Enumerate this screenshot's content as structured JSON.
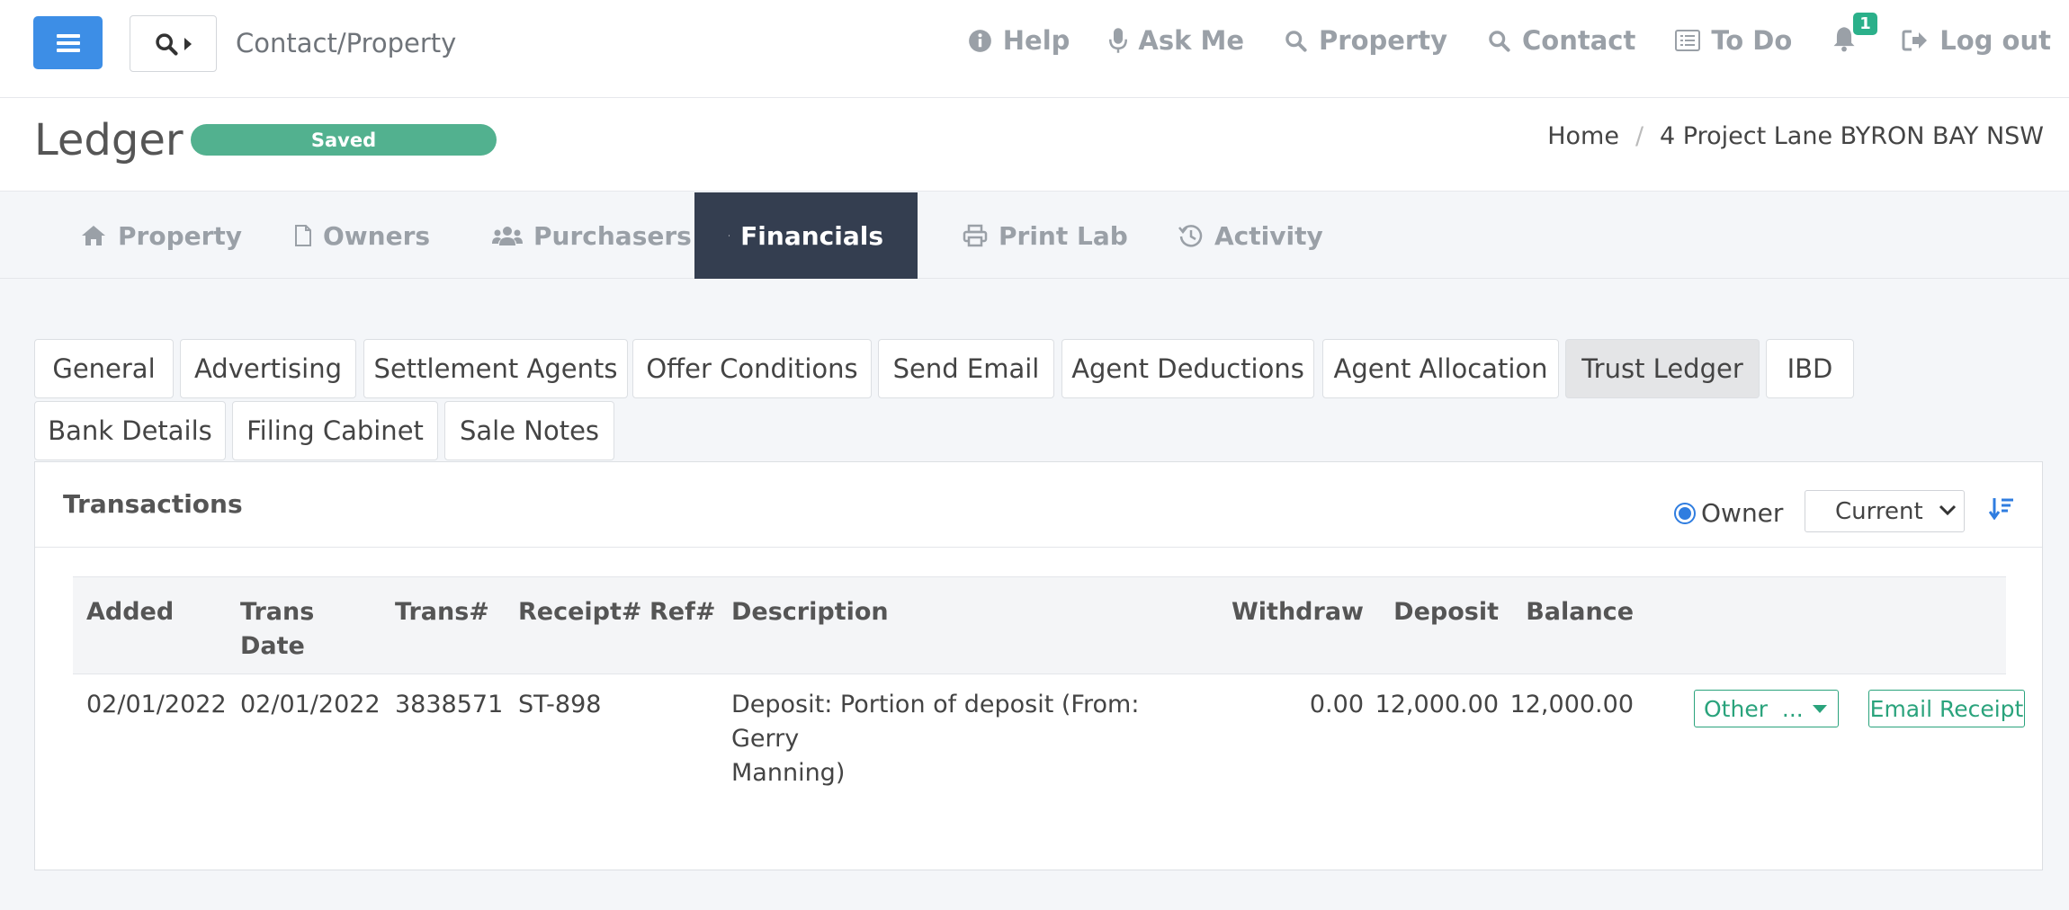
{
  "topbar": {
    "search_label": "Contact/Property",
    "nav": [
      {
        "label": "Help",
        "icon": "info-circle-icon"
      },
      {
        "label": "Ask Me",
        "icon": "microphone-icon"
      },
      {
        "label": "Property",
        "icon": "search-icon"
      },
      {
        "label": "Contact",
        "icon": "search-icon"
      },
      {
        "label": "To Do",
        "icon": "list-icon"
      }
    ],
    "notifications_count": "1",
    "logout_label": "Log out"
  },
  "header": {
    "title": "Ledger",
    "status": "Saved",
    "breadcrumb": {
      "home": "Home",
      "separator": "/",
      "current": "4 Project Lane BYRON BAY NSW"
    }
  },
  "main_tabs": [
    {
      "label": "Property",
      "icon": "home-icon"
    },
    {
      "label": "Owners",
      "icon": "file-icon"
    },
    {
      "label": "Purchasers",
      "icon": "users-icon"
    },
    {
      "label": "Financials",
      "icon": "calculator-icon",
      "active": true
    },
    {
      "label": "Print Lab",
      "icon": "printer-icon"
    },
    {
      "label": "Activity",
      "icon": "history-icon"
    }
  ],
  "sub_tabs": [
    {
      "label": "General"
    },
    {
      "label": "Advertising"
    },
    {
      "label": "Settlement Agents"
    },
    {
      "label": "Offer Conditions"
    },
    {
      "label": "Send Email"
    },
    {
      "label": "Agent Deductions"
    },
    {
      "label": "Agent Allocation"
    },
    {
      "label": "Trust Ledger",
      "active": true
    },
    {
      "label": "IBD"
    },
    {
      "label": "Bank Details"
    },
    {
      "label": "Filing Cabinet"
    },
    {
      "label": "Sale Notes"
    }
  ],
  "panel": {
    "title": "Transactions",
    "owner_label": "Owner",
    "period_value": "Current",
    "columns": {
      "added": "Added",
      "trans_date_1": "Trans",
      "trans_date_2": "Date",
      "trans_no": "Trans#",
      "receipt_no": "Receipt#",
      "ref_no": "Ref#",
      "description": "Description",
      "withdraw": "Withdraw",
      "deposit": "Deposit",
      "balance": "Balance"
    },
    "rows": [
      {
        "added": "02/01/2022",
        "trans_date": "02/01/2022",
        "trans_no": "3838571",
        "receipt_no": "ST-898",
        "ref_no": "",
        "description_1": "Deposit: Portion of deposit (From: Gerry",
        "description_2": "Manning)",
        "withdraw": "0.00",
        "deposit": "12,000.00",
        "balance": "12,000.00",
        "action_label": "Other  ...",
        "email_label": "Email Receipt"
      }
    ]
  },
  "colors": {
    "primary": "#3d8ee6",
    "dark_tab": "#343e50",
    "success": "#52b18f",
    "action_green": "#2aa37c"
  }
}
